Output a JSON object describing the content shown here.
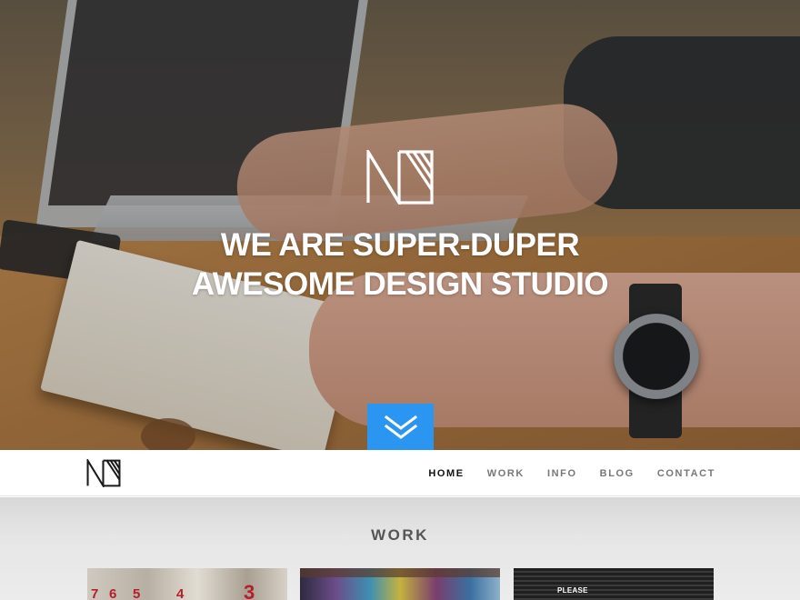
{
  "hero": {
    "headline_line1": "WE ARE SUPER-DUPER",
    "headline_line2": "AWESOME DESIGN STUDIO",
    "logo_icon": "studio-monogram-logo",
    "scroll_icon": "double-chevron-down-icon",
    "scroll_button_color": "#2b95f2"
  },
  "nav": {
    "logo_icon": "studio-monogram-logo",
    "items": [
      {
        "label": "HOME",
        "active": true
      },
      {
        "label": "WORK",
        "active": false
      },
      {
        "label": "INFO",
        "active": false
      },
      {
        "label": "BLOG",
        "active": false
      },
      {
        "label": "CONTACT",
        "active": false
      }
    ]
  },
  "work": {
    "title": "WORK",
    "thumbnails": [
      {
        "name": "numbered-pillars",
        "labels": [
          "7",
          "6",
          "5",
          "4",
          "3"
        ]
      },
      {
        "name": "graffiti-wall"
      },
      {
        "name": "please-sign",
        "label": "PLEASE"
      }
    ]
  }
}
